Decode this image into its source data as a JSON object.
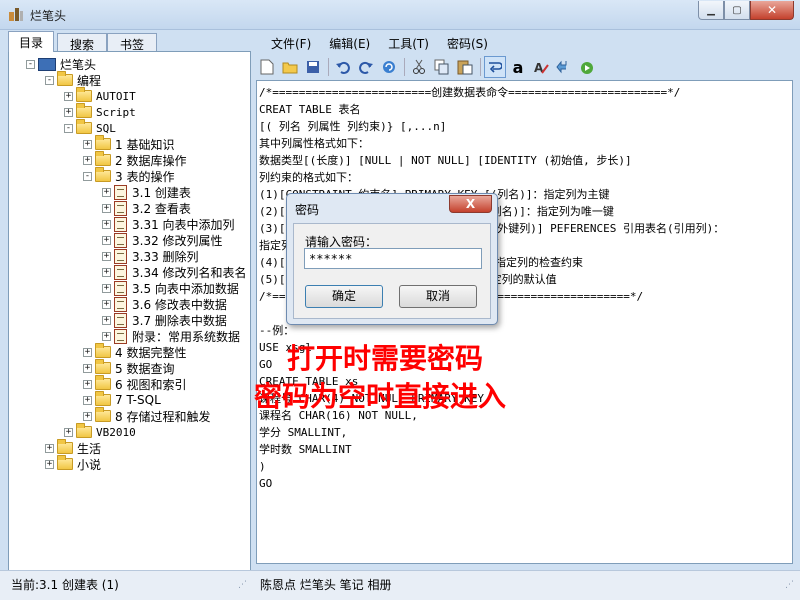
{
  "window": {
    "title": "烂笔头"
  },
  "left_tabs": [
    "目录",
    "搜索",
    "书签"
  ],
  "tree": [
    {
      "label": "烂笔头",
      "kind": "pc",
      "depth": 0,
      "expander": "-"
    },
    {
      "label": "编程",
      "kind": "folder",
      "depth": 1,
      "expander": "-"
    },
    {
      "label": "AUTOIT",
      "kind": "folder",
      "depth": 2,
      "expander": "+",
      "mono": true
    },
    {
      "label": "Script",
      "kind": "folder",
      "depth": 2,
      "expander": "+",
      "mono": true
    },
    {
      "label": "SQL",
      "kind": "folder",
      "depth": 2,
      "expander": "-",
      "mono": true
    },
    {
      "label": "1 基础知识",
      "kind": "folder",
      "depth": 3,
      "expander": "+"
    },
    {
      "label": "2 数据库操作",
      "kind": "folder",
      "depth": 3,
      "expander": "+"
    },
    {
      "label": "3 表的操作",
      "kind": "folder",
      "depth": 3,
      "expander": "-"
    },
    {
      "label": "3.1 创建表",
      "kind": "doc",
      "depth": 4,
      "expander": "+"
    },
    {
      "label": "3.2 查看表",
      "kind": "doc",
      "depth": 4,
      "expander": "+"
    },
    {
      "label": "3.31 向表中添加列",
      "kind": "doc",
      "depth": 4,
      "expander": "+"
    },
    {
      "label": "3.32 修改列属性",
      "kind": "doc",
      "depth": 4,
      "expander": "+"
    },
    {
      "label": "3.33 删除列",
      "kind": "doc",
      "depth": 4,
      "expander": "+"
    },
    {
      "label": "3.34 修改列名和表名",
      "kind": "doc",
      "depth": 4,
      "expander": "+"
    },
    {
      "label": "3.5 向表中添加数据",
      "kind": "doc",
      "depth": 4,
      "expander": "+"
    },
    {
      "label": "3.6 修改表中数据",
      "kind": "doc",
      "depth": 4,
      "expander": "+"
    },
    {
      "label": "3.7 删除表中数据",
      "kind": "doc",
      "depth": 4,
      "expander": "+"
    },
    {
      "label": "附录：常用系统数据",
      "kind": "doc",
      "depth": 4,
      "expander": "+"
    },
    {
      "label": "4 数据完整性",
      "kind": "folder",
      "depth": 3,
      "expander": "+"
    },
    {
      "label": "5 数据查询",
      "kind": "folder",
      "depth": 3,
      "expander": "+"
    },
    {
      "label": "6 视图和索引",
      "kind": "folder",
      "depth": 3,
      "expander": "+"
    },
    {
      "label": "7 T-SQL",
      "kind": "folder",
      "depth": 3,
      "expander": "+"
    },
    {
      "label": "8 存储过程和触发",
      "kind": "folder",
      "depth": 3,
      "expander": "+"
    },
    {
      "label": "VB2010",
      "kind": "folder",
      "depth": 2,
      "expander": "+",
      "mono": true
    },
    {
      "label": "生活",
      "kind": "folder",
      "depth": 1,
      "expander": "+"
    },
    {
      "label": "小说",
      "kind": "folder",
      "depth": 1,
      "expander": "+"
    }
  ],
  "menu": [
    "文件(F)",
    "编辑(E)",
    "工具(T)",
    "密码(S)"
  ],
  "toolbar_icons": [
    "new-file-icon",
    "open-folder-icon",
    "save-icon",
    "undo-icon",
    "redo-icon",
    "refresh-icon",
    "cut-icon",
    "copy-icon",
    "paste-icon",
    "word-wrap-icon",
    "font-icon",
    "clear-format-icon",
    "back-icon",
    "run-icon"
  ],
  "editor_lines": [
    "/*========================创建数据表命令========================*/",
    "CREAT TABLE 表名",
    "[( 列名 列属性 列约束)} [,...n]",
    "其中列属性格式如下：",
    "数据类型[(长度)] [NULL | NOT NULL] [IDENTITY (初始值, 步长)]",
    "列约束的格式如下：",
    "(1)[CONSTRAINT 约束名] PRIMARY KEY [(列名)]：指定列为主键",
    "(2)[CONSTRAINT 约束名] UNIQUE KEY [(列名)]：指定列为唯一键",
    "(3)[CONSTRAINT 约束名] FOREIGN KEY [(外键列)] PEFERENCES 引用表名(引用列)：",
    "指定列为外键，引用其他表中所用的列名",
    "(4)[CONSTRAINT 约束名] CHECK(表达式)：指定列的检查约束",
    "(5)[CONSTRAINT 约束名] DEFAULT 值：指定列的默认值",
    "/*=========================END==========================*/",
    "",
    "--例：",
    "USE xsgl",
    "GO",
    "CREATE TABLE xs",
    "课程号 CHAR(4) NOT NULL PRIMARY KEY,",
    "课程名 CHAR(16) NOT NULL,",
    "学分 SMALLINT,",
    "学时数 SMALLINT",
    ")",
    "GO"
  ],
  "overlay": {
    "line1": "打开时需要密码",
    "line2": "密码为空时直接进入"
  },
  "dialog": {
    "title": "密码",
    "close": "X",
    "label": "请输入密码：",
    "value": "******",
    "ok": "确定",
    "cancel": "取消"
  },
  "status": {
    "left": "当前:3.1 创建表 (1)",
    "right": "陈恩点 烂笔头 笔记 相册"
  },
  "colors": {
    "overlay_text": "#ff0000",
    "close_button": "#c4412d"
  }
}
